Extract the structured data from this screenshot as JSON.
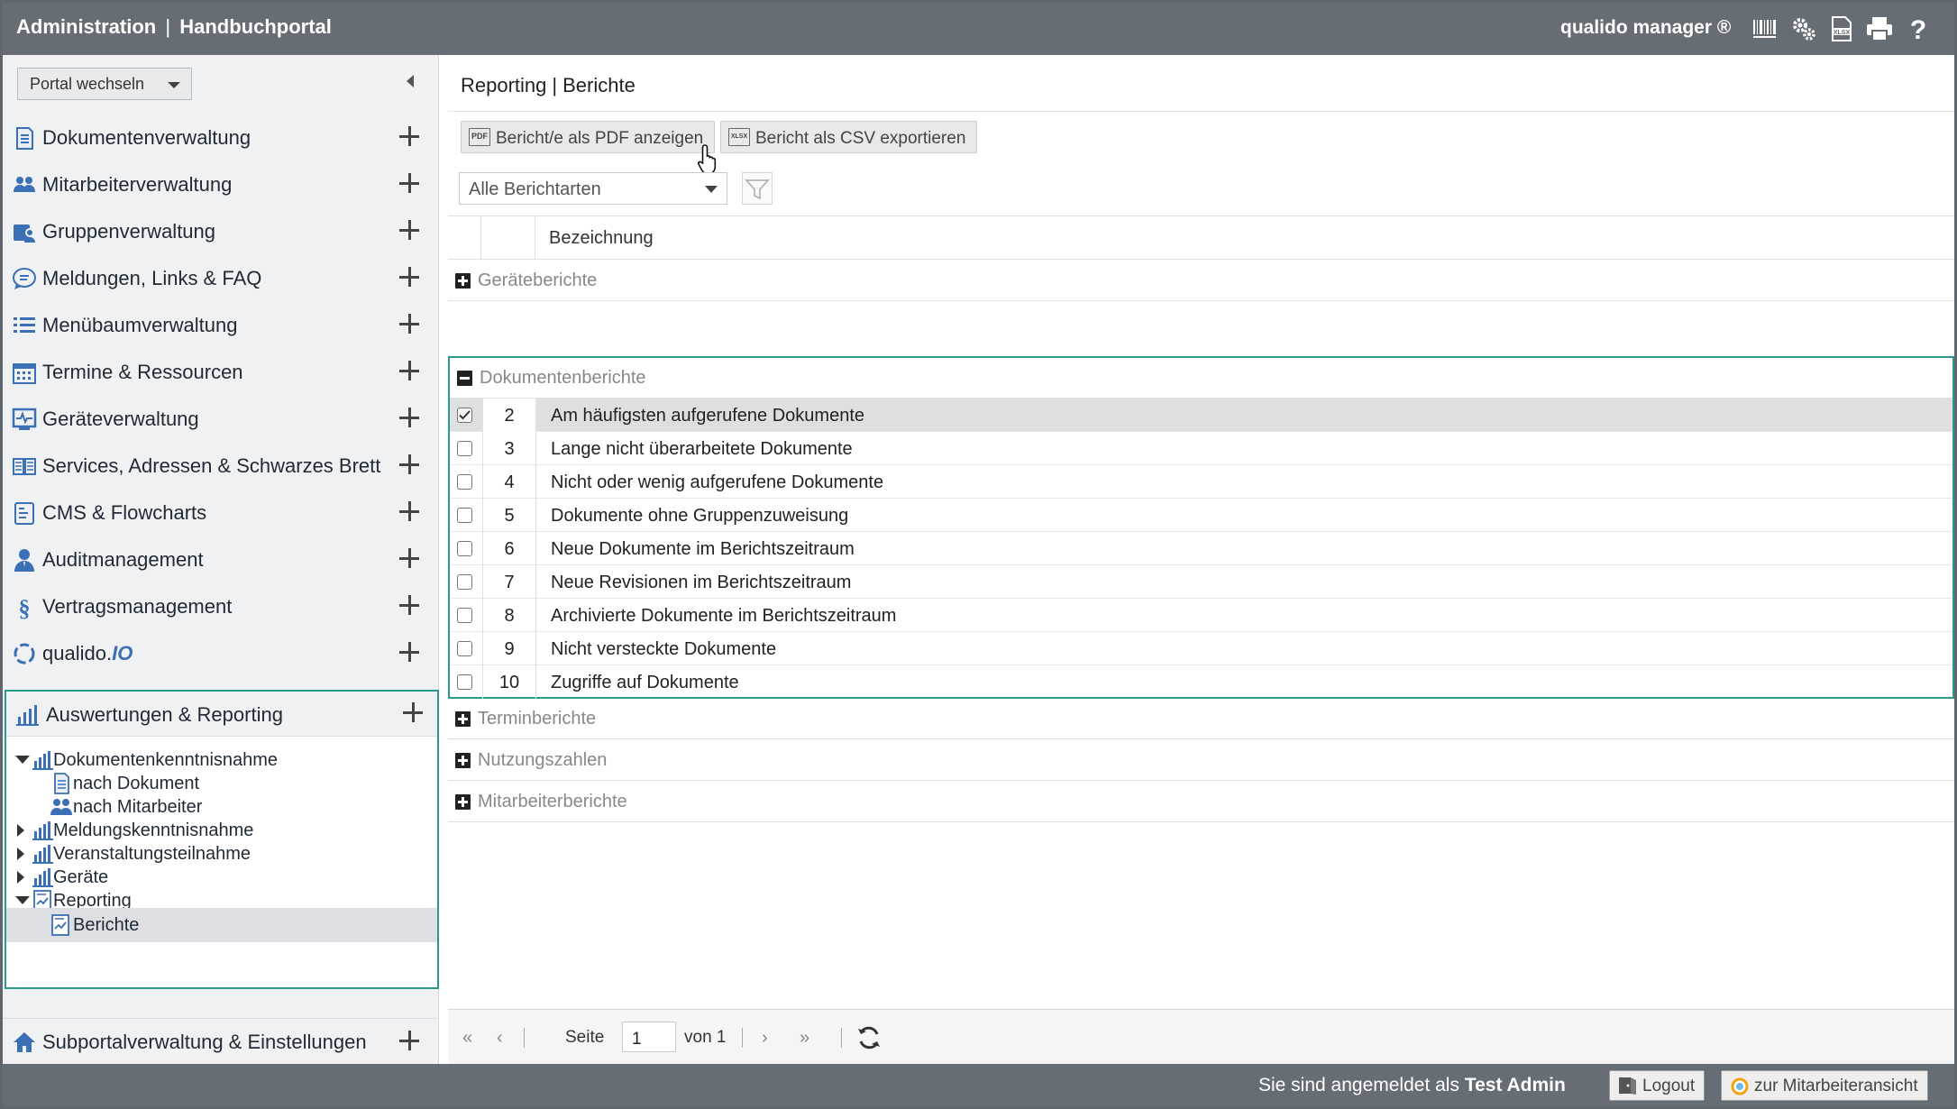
{
  "header": {
    "title_part1": "Administration",
    "title_sep": "|",
    "title_part2": "Handbuchportal",
    "brand": "qualido manager ®",
    "icons": [
      "barcode-icon",
      "settings-icon",
      "export-xlsx-icon",
      "print-icon",
      "help-icon"
    ]
  },
  "sidebar": {
    "portal_select": "Portal wechseln",
    "items": [
      {
        "label": "Dokumentenverwaltung",
        "icon": "document-icon"
      },
      {
        "label": "Mitarbeiterverwaltung",
        "icon": "users-icon"
      },
      {
        "label": "Gruppenverwaltung",
        "icon": "group-icon"
      },
      {
        "label": "Meldungen, Links & FAQ",
        "icon": "chat-icon"
      },
      {
        "label": "Menübaumverwaltung",
        "icon": "list-icon"
      },
      {
        "label": "Termine & Ressourcen",
        "icon": "calendar-icon"
      },
      {
        "label": "Geräteverwaltung",
        "icon": "device-icon"
      },
      {
        "label": "Services, Adressen & Schwarzes Brett",
        "icon": "book-icon"
      },
      {
        "label": "CMS & Flowcharts",
        "icon": "cms-icon"
      },
      {
        "label": "Auditmanagement",
        "icon": "auditor-icon"
      },
      {
        "label": "Vertragsmanagement",
        "icon": "paragraph-icon"
      },
      {
        "label": "qualido.",
        "label_suffix": "IO",
        "icon": "qualido-io-icon"
      }
    ],
    "active_section": {
      "label": "Auswertungen & Reporting",
      "tree": [
        {
          "label": "Dokumentenkenntnisnahme",
          "expanded": true
        },
        {
          "label": "nach Dokument"
        },
        {
          "label": "nach Mitarbeiter"
        },
        {
          "label": "Meldungskenntnisnahme",
          "expanded": false
        },
        {
          "label": "Veranstaltungsteilnahme",
          "expanded": false
        },
        {
          "label": "Geräte",
          "expanded": false
        },
        {
          "label": "Reporting",
          "expanded": true
        },
        {
          "label": "Berichte",
          "selected": true
        }
      ]
    },
    "bottom_item": {
      "label": "Subportalverwaltung & Einstellungen",
      "icon": "home-icon"
    }
  },
  "main": {
    "breadcrumb_part1": "Reporting",
    "breadcrumb_sep": "|",
    "breadcrumb_part2": "Berichte",
    "toolbar": {
      "pdf_label": "Bericht/e als PDF anzeigen",
      "pdf_icon_text": "PDF",
      "csv_label": "Bericht als CSV exportieren",
      "csv_icon_text": "XLSX"
    },
    "filter": {
      "report_type": "Alle Berichtarten"
    },
    "grid": {
      "column_header": "Bezeichnung",
      "groups": [
        {
          "label": "Geräteberichte",
          "expanded": false
        },
        {
          "label": "Dokumentenberichte",
          "expanded": true
        },
        {
          "label": "Terminberichte",
          "expanded": false
        },
        {
          "label": "Nutzungszahlen",
          "expanded": false
        },
        {
          "label": "Mitarbeiterberichte",
          "expanded": false
        }
      ],
      "rows": [
        {
          "num": "2",
          "label": "Am häufigsten aufgerufene Dokumente",
          "checked": true
        },
        {
          "num": "3",
          "label": "Lange nicht überarbeitete Dokumente",
          "checked": false
        },
        {
          "num": "4",
          "label": "Nicht oder wenig aufgerufene Dokumente",
          "checked": false
        },
        {
          "num": "5",
          "label": "Dokumente ohne Gruppenzuweisung",
          "checked": false
        },
        {
          "num": "6",
          "label": "Neue Dokumente im Berichtszeitraum",
          "checked": false
        },
        {
          "num": "7",
          "label": "Neue Revisionen im Berichtszeitraum",
          "checked": false
        },
        {
          "num": "8",
          "label": "Archivierte Dokumente im Berichtszeitraum",
          "checked": false
        },
        {
          "num": "9",
          "label": "Nicht versteckte Dokumente",
          "checked": false
        },
        {
          "num": "10",
          "label": "Zugriffe auf Dokumente",
          "checked": false
        }
      ]
    },
    "pager": {
      "page_label": "Seite",
      "page_value": "1",
      "of_label": "von 1"
    }
  },
  "footer": {
    "logged_in_prefix": "Sie sind angemeldet als",
    "user": "Test Admin",
    "logout_label": "Logout",
    "employee_view_label": "zur Mitarbeiteransicht"
  },
  "colors": {
    "header_bg": "#666d75",
    "accent": "#2a9a8f",
    "icon_blue": "#3b6fb6"
  }
}
